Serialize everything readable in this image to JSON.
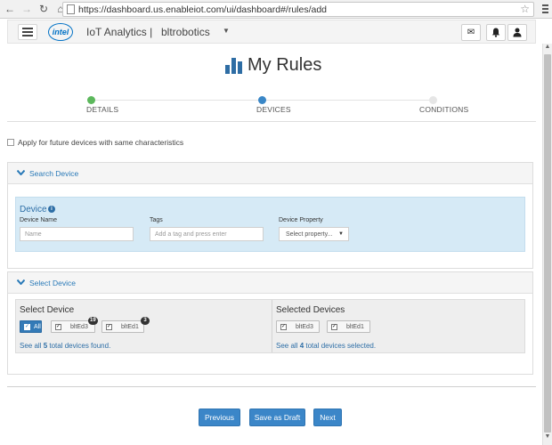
{
  "browser": {
    "url": "https://dashboard.us.enableiot.com/ui/dashboard#/rules/add"
  },
  "header": {
    "app_title": "IoT Analytics |",
    "account_name": "bltrobotics",
    "logo_text": "intel"
  },
  "page": {
    "title": "My Rules"
  },
  "wizard": {
    "steps": [
      {
        "label": "DETAILS",
        "color": "#5cb85c"
      },
      {
        "label": "DEVICES",
        "color": "#3a87c7"
      },
      {
        "label": "CONDITIONS",
        "color": "#e6e6e6"
      }
    ]
  },
  "future_devices_label": "Apply for future devices with same characteristics",
  "search_panel": {
    "title": "Search Device",
    "heading": "Device",
    "fields": {
      "name_label": "Device Name",
      "name_placeholder": "Name",
      "tags_label": "Tags",
      "tags_placeholder": "Add a tag and press enter",
      "property_label": "Device Property",
      "property_value": "Select property..."
    }
  },
  "select_panel": {
    "title": "Select Device",
    "select_heading": "Select Device",
    "selected_heading": "Selected Devices",
    "all_label": "All",
    "devices": [
      {
        "name": "bltEd3",
        "count": "19"
      },
      {
        "name": "bltEd1",
        "count": "3"
      }
    ],
    "selected": [
      {
        "name": "bltEd3"
      },
      {
        "name": "bltEd1"
      }
    ],
    "found_note": {
      "prefix": "See all ",
      "count": "5",
      "suffix": " total devices found."
    },
    "selected_note": {
      "prefix": "See all ",
      "count": "4",
      "suffix": " total devices selected."
    }
  },
  "buttons": {
    "previous": "Previous",
    "save_draft": "Save as Draft",
    "next": "Next"
  }
}
